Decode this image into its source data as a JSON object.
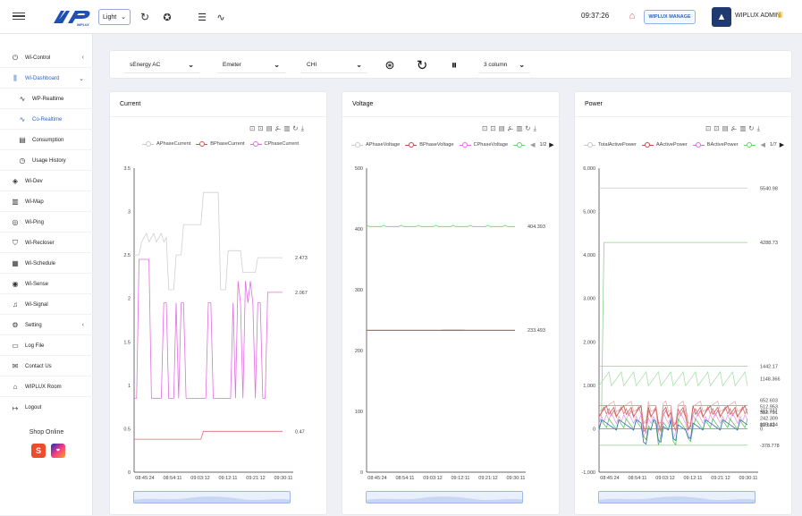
{
  "header": {
    "theme": "Light",
    "clock": "09:37:26",
    "manage_label": "WIPLUX MANAGE",
    "user": "WIPLUX ADMIN"
  },
  "sidebar": {
    "items": [
      {
        "label": "Wi-Control",
        "icon": "power-icon"
      },
      {
        "label": "Wi-Dashboard",
        "icon": "bars-icon"
      },
      {
        "label": "WP-Realtime",
        "icon": "pulse-icon"
      },
      {
        "label": "Co-Realtime",
        "icon": "pulse-icon"
      },
      {
        "label": "Consumption",
        "icon": "document-icon"
      },
      {
        "label": "Usage History",
        "icon": "clock-icon"
      },
      {
        "label": "Wi-Dev",
        "icon": "layers-icon"
      },
      {
        "label": "Wi-Map",
        "icon": "map-icon"
      },
      {
        "label": "Wi-Ping",
        "icon": "signal-icon"
      },
      {
        "label": "Wi-Recloser",
        "icon": "shield-icon"
      },
      {
        "label": "Wi-Schedule",
        "icon": "calendar-icon"
      },
      {
        "label": "Wi-Sense",
        "icon": "broadcast-icon"
      },
      {
        "label": "Wi-Signal",
        "icon": "bell-icon"
      },
      {
        "label": "Setting",
        "icon": "gear-icon"
      },
      {
        "label": "Log File",
        "icon": "folder-icon"
      },
      {
        "label": "Contact Us",
        "icon": "mail-icon"
      },
      {
        "label": "WIPLUX Room",
        "icon": "home-icon"
      },
      {
        "label": "Logout",
        "icon": "logout-icon"
      }
    ],
    "shop_label": "Shop Online"
  },
  "filters": {
    "device": "sEnergy AC",
    "meter": "Emeter",
    "site": "CHI",
    "columns": "3 column"
  },
  "panels": {
    "current": {
      "title": "Current",
      "legend": [
        "APhaseCurrent",
        "BPhaseCurrent",
        "CPhaseCurrent"
      ]
    },
    "voltage": {
      "title": "Voltage",
      "legend": [
        "APhaseVoltage",
        "BPhaseVoltage",
        "CPhaseVoltage"
      ],
      "page": "1/2"
    },
    "power": {
      "title": "Power",
      "legend": [
        "TotalActivePower",
        "AActivePower",
        "BActivePower"
      ],
      "page": "1/7"
    }
  },
  "chart_data": [
    {
      "type": "line",
      "title": "Current",
      "x": [
        "08:45:24",
        "08:54:11",
        "09:03:12",
        "09:12:11",
        "09:21:12",
        "09:30:11"
      ],
      "ylim": [
        0,
        3.5
      ],
      "yticks": [
        "0",
        "0.5",
        "1",
        "1.5",
        "2",
        "2.5",
        "3",
        "3.5"
      ],
      "series": [
        {
          "name": "APhaseCurrent",
          "color": "#cfcfd6",
          "last": "2.473"
        },
        {
          "name": "BPhaseCurrent",
          "color": "#e06a6a",
          "last": "0.47"
        },
        {
          "name": "CPhaseCurrent",
          "color": "#e26ee2",
          "last": "2.067"
        }
      ]
    },
    {
      "type": "line",
      "title": "Voltage",
      "x": [
        "08:45:24",
        "08:54:11",
        "09:03:12",
        "09:12:11",
        "09:21:12",
        "09:30:11"
      ],
      "ylim": [
        0,
        500
      ],
      "yticks": [
        "0",
        "100",
        "200",
        "300",
        "400",
        "500"
      ],
      "series": [
        {
          "name": "APhaseVoltage",
          "color": "#cfcfd6",
          "last": "233.493"
        },
        {
          "name": "BPhaseVoltage",
          "color": "#d04848",
          "last": "233.4"
        },
        {
          "name": "CPhaseVoltage",
          "color": "#e26ee2",
          "last": "233.1"
        },
        {
          "name": "",
          "color": "#6cd06c",
          "last": "404.393"
        }
      ]
    },
    {
      "type": "line",
      "title": "Power",
      "x": [
        "08:45:24",
        "08:54:11",
        "09:03:12",
        "09:12:11",
        "09:21:12",
        "09:30:11"
      ],
      "ylim": [
        -1000,
        6000
      ],
      "yticks": [
        "-1,000",
        "0",
        "1,000",
        "2,000",
        "3,000",
        "4,000",
        "5,000",
        "6,000"
      ],
      "labels": [
        "5540.98",
        "4288.73",
        "1442.17",
        "1148.366",
        "652.603",
        "512.953",
        "411.737",
        "382.791",
        "242.309",
        "105.434",
        "89.531",
        "0",
        "-378.778"
      ]
    }
  ]
}
